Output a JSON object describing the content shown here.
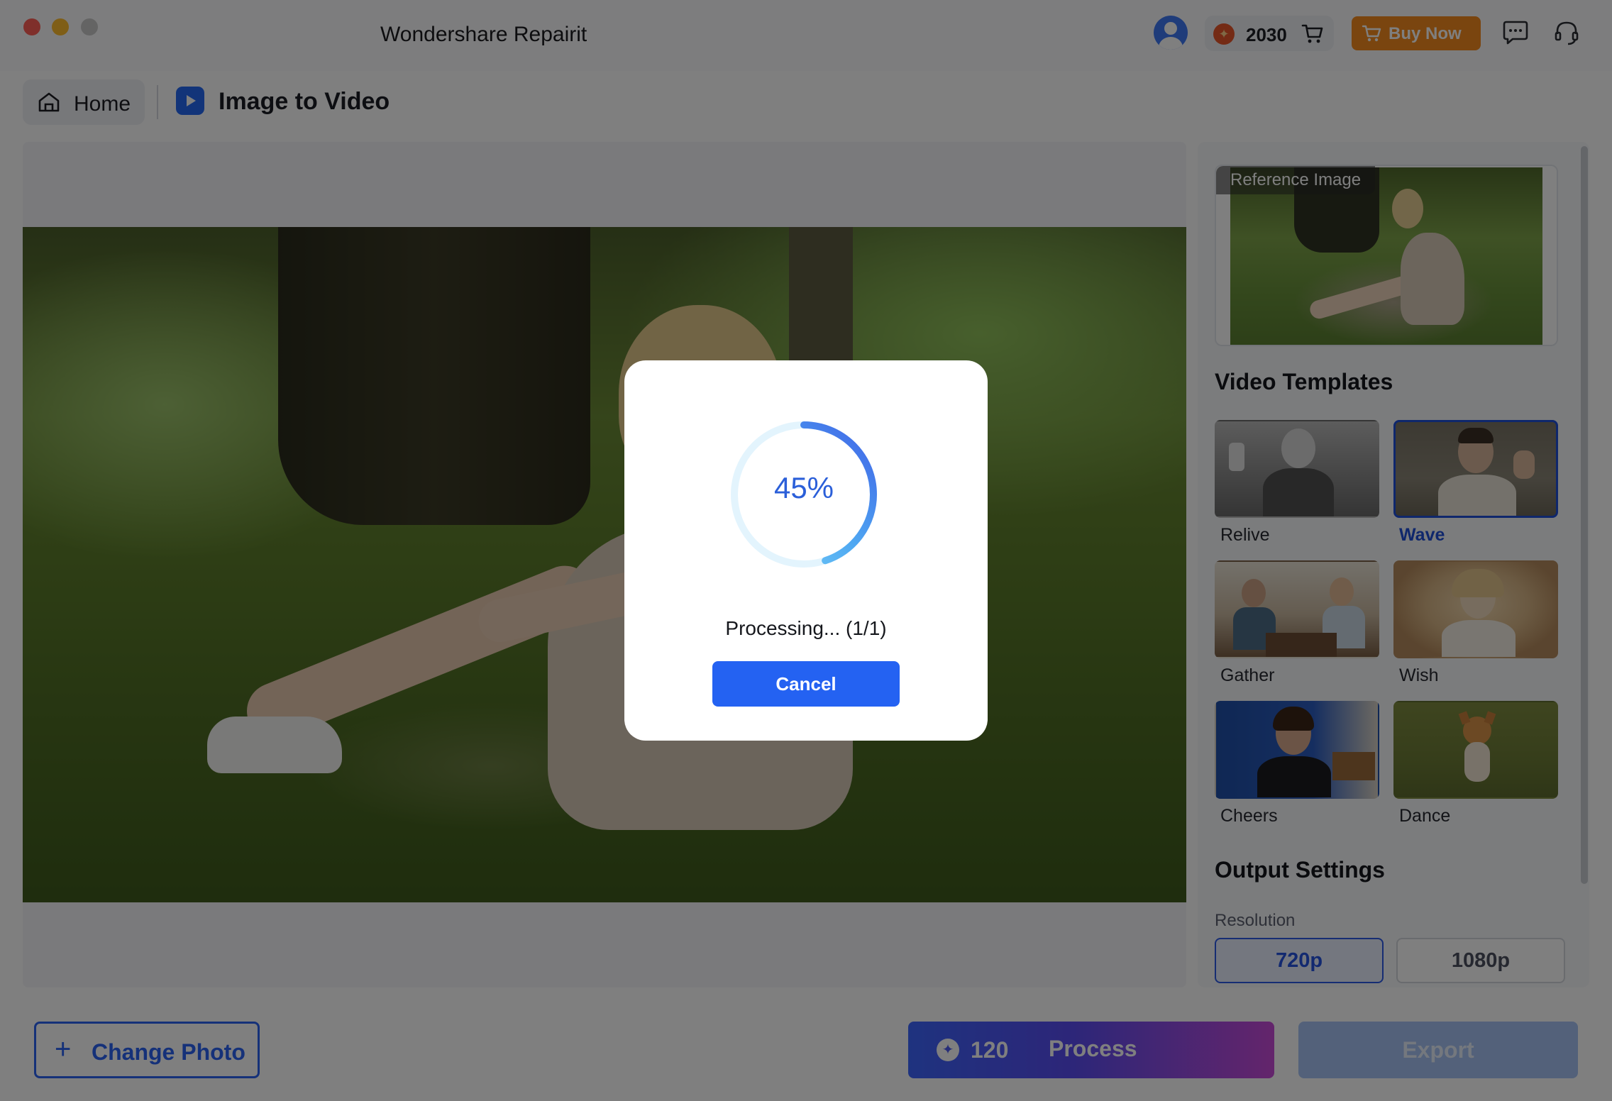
{
  "window": {
    "title": "Wondershare Repairit"
  },
  "header": {
    "credits": "2030",
    "buy_now_label": "Buy Now"
  },
  "breadcrumb": {
    "home_label": "Home",
    "page_title": "Image to Video"
  },
  "side_panel": {
    "reference_label": "Reference Image",
    "templates_title": "Video Templates",
    "templates": [
      {
        "label": "Relive",
        "selected": false
      },
      {
        "label": "Wave",
        "selected": true
      },
      {
        "label": "Gather",
        "selected": false
      },
      {
        "label": "Wish",
        "selected": false
      },
      {
        "label": "Cheers",
        "selected": false
      },
      {
        "label": "Dance",
        "selected": false
      }
    ],
    "output_title": "Output Settings",
    "resolution_label": "Resolution",
    "resolutions": [
      {
        "label": "720p",
        "selected": true
      },
      {
        "label": "1080p",
        "selected": false
      }
    ]
  },
  "bottom_bar": {
    "change_photo_label": "Change Photo",
    "process_cost": "120",
    "process_label": "Process",
    "export_label": "Export"
  },
  "dialog": {
    "progress_text": "45%",
    "progress_fraction": 0.45,
    "status": "Processing... (1/1)",
    "cancel_label": "Cancel"
  },
  "colors": {
    "accent": "#2462f2",
    "buy_now": "#f58a1f",
    "selected_template": "#1f4fd8"
  }
}
